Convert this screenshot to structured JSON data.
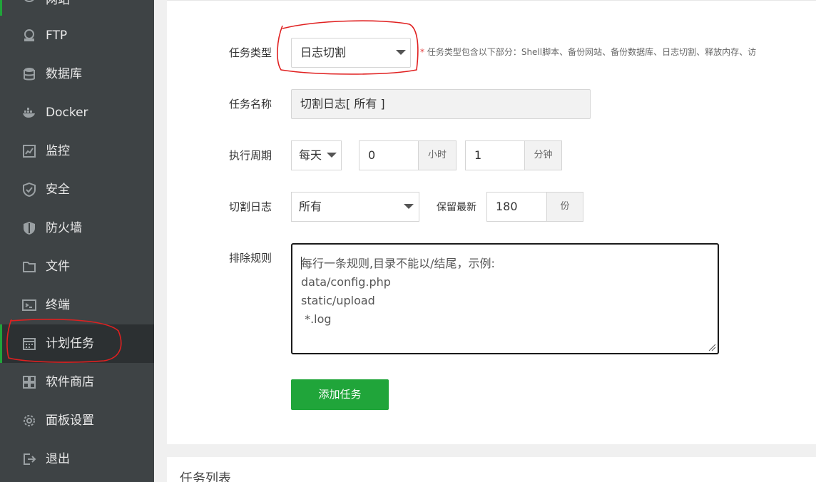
{
  "sidebar": {
    "top_partial_label": "网站",
    "items": [
      {
        "label": "FTP",
        "icon": "ftp-icon"
      },
      {
        "label": "数据库",
        "icon": "database-icon"
      },
      {
        "label": "Docker",
        "icon": "docker-icon"
      },
      {
        "label": "监控",
        "icon": "monitor-icon"
      },
      {
        "label": "安全",
        "icon": "shield-icon"
      },
      {
        "label": "防火墙",
        "icon": "firewall-icon"
      },
      {
        "label": "文件",
        "icon": "folder-icon"
      },
      {
        "label": "终端",
        "icon": "terminal-icon"
      },
      {
        "label": "计划任务",
        "icon": "calendar-icon",
        "active": true
      },
      {
        "label": "软件商店",
        "icon": "apps-icon"
      },
      {
        "label": "面板设置",
        "icon": "gear-icon"
      },
      {
        "label": "退出",
        "icon": "logout-icon"
      }
    ]
  },
  "form": {
    "task_type": {
      "label": "任务类型",
      "value": "日志切割",
      "hint_star": "*",
      "hint": "任务类型包含以下部分：Shell脚本、备份网站、备份数据库、日志切割、释放内存、访"
    },
    "task_name": {
      "label": "任务名称",
      "value": "切割日志[ 所有 ]"
    },
    "period": {
      "label": "执行周期",
      "cycle": "每天",
      "hour_value": "0",
      "hour_unit": "小时",
      "minute_value": "1",
      "minute_unit": "分钟"
    },
    "cut_log": {
      "label": "切割日志",
      "value": "所有",
      "keep_label": "保留最新",
      "keep_value": "180",
      "keep_unit": "份"
    },
    "exclude": {
      "label": "排除规则",
      "placeholder": "每行一条规则,目录不能以/结尾，示例:\ndata/config.php\nstatic/upload\n *.log"
    },
    "submit_label": "添加任务"
  },
  "task_list": {
    "title": "任务列表"
  },
  "colors": {
    "accent": "#20a53a",
    "sidebar_bg": "#3e4345",
    "annotation": "#e02020"
  }
}
